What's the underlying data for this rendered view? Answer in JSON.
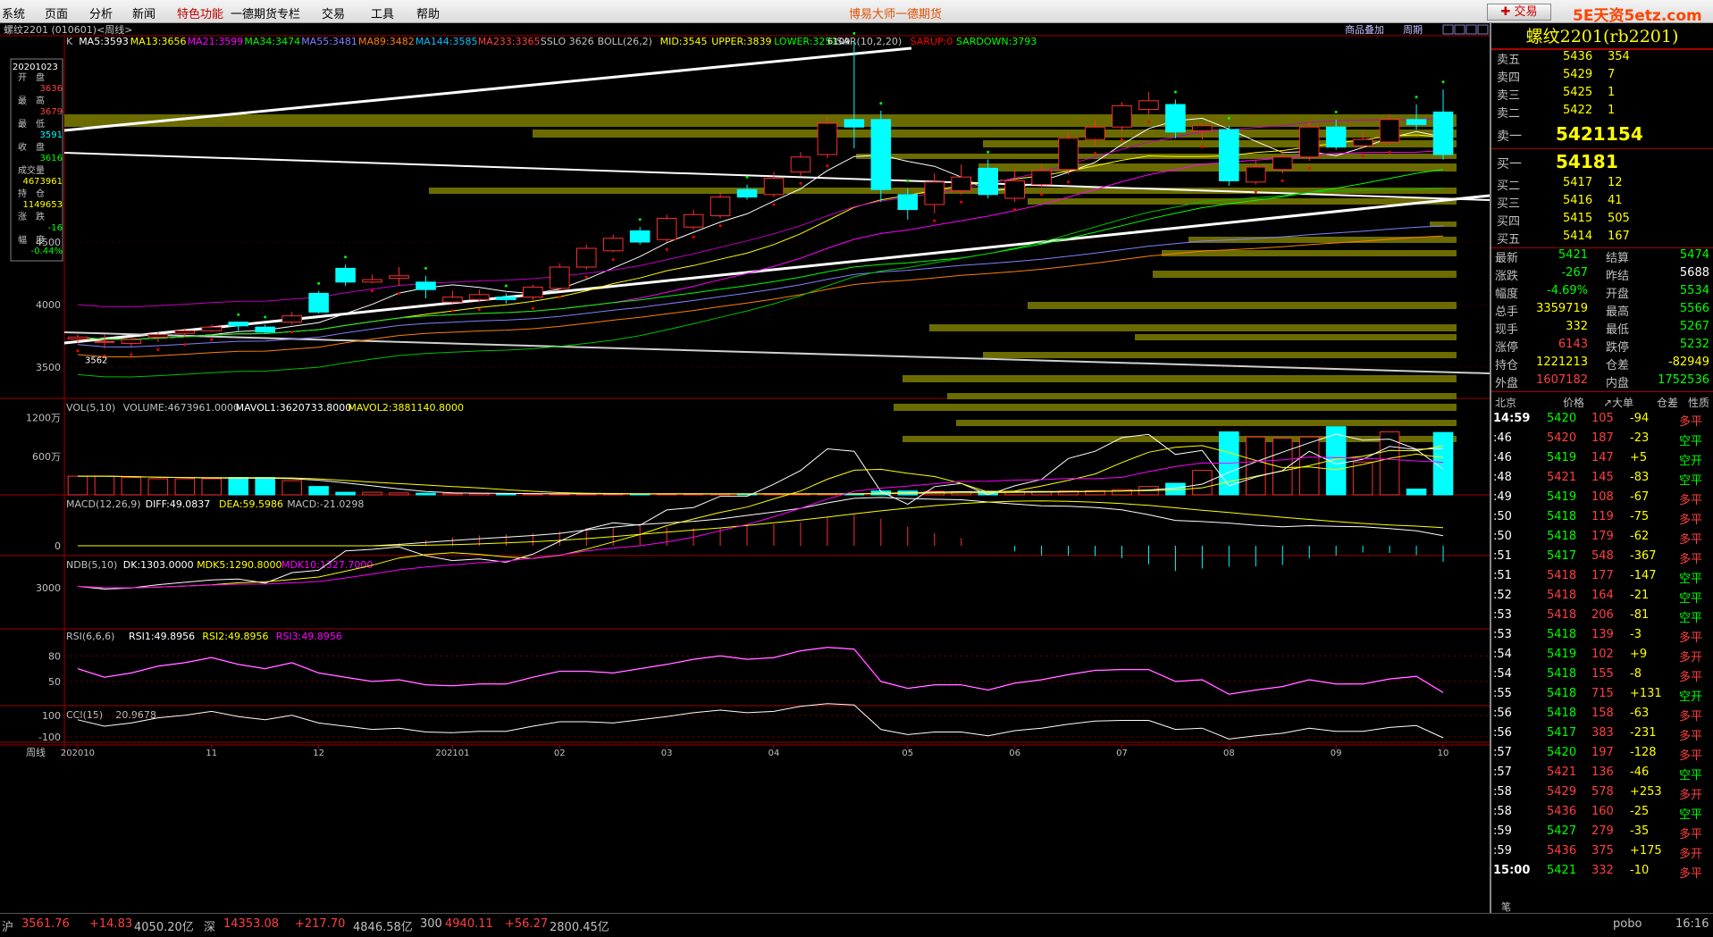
{
  "menu": [
    "系统",
    "页面",
    "分析",
    "新闻",
    "特色功能",
    "一德期货专栏",
    "交易",
    "工具",
    "帮助"
  ],
  "app_title": "博易大师一德期货",
  "trade_button": "交易",
  "watermark": "5E天资5etz.com",
  "chart_header": {
    "symbol": "螺纹2201 (010601)<周线>",
    "overlay_btn": "商品叠加",
    "period_btn": "周期"
  },
  "info_box": {
    "date": "20201023",
    "rows": [
      [
        "开　盘",
        "3636",
        "#ff4040"
      ],
      [
        "最　高",
        "3679",
        "#ff4040"
      ],
      [
        "最　低",
        "3591",
        "#00ffff"
      ],
      [
        "收　盘",
        "3616",
        "#00ff00"
      ],
      [
        "成交量",
        "4673961",
        "#ffff00"
      ],
      [
        "持　仓",
        "1149653",
        "#ffff00"
      ],
      [
        "涨　跌",
        "-16",
        "#00ff00"
      ],
      [
        "幅　度",
        "-0.44%",
        "#00ff00"
      ]
    ]
  },
  "indicators": {
    "ma_line": [
      [
        "K",
        "#c0c0c0"
      ],
      [
        "MA5:3593",
        "#ffffff"
      ],
      [
        "MA13:3656",
        "#ffff00"
      ],
      [
        "MA21:3599",
        "#ff00ff"
      ],
      [
        "MA34:3474",
        "#00ff00"
      ],
      [
        "MA55:3481",
        "#8080ff"
      ],
      [
        "MA89:3482",
        "#ff8000"
      ],
      [
        "MA144:3585",
        "#00c0ff"
      ],
      [
        "MA233:3365",
        "#ff4040"
      ],
      [
        "SSLO 3626",
        "#c0c0c0"
      ],
      [
        "BOLL(26,2)",
        "#c0c0c0"
      ],
      [
        "MID:3545",
        "#ffff00"
      ],
      [
        "UPPER:3839",
        "#ffff00"
      ],
      [
        "LOWER:3251",
        "#00ff00"
      ],
      [
        "SAR(10,2,20)",
        "#c0c0c0"
      ],
      [
        "SARUP:0",
        "#ff0000"
      ],
      [
        "SARDOWN:3793",
        "#00ff00"
      ]
    ],
    "vol": [
      [
        "VOL(5,10)",
        "#c0c0c0"
      ],
      [
        "VOLUME:4673961.0000",
        "#c0c0c0"
      ],
      [
        "MAVOL1:3620733.8000",
        "#ffffff"
      ],
      [
        "MAVOL2:3881140.8000",
        "#ffff00"
      ]
    ],
    "macd": [
      [
        "MACD(12,26,9)",
        "#c0c0c0"
      ],
      [
        "DIFF:49.0837",
        "#ffffff"
      ],
      [
        "DEA:59.5986",
        "#ffff00"
      ],
      [
        "MACD:-21.0298",
        "#c0c0c0"
      ]
    ],
    "ndb": [
      [
        "NDB(5,10)",
        "#c0c0c0"
      ],
      [
        "DK:1303.0000",
        "#ffffff"
      ],
      [
        "MDK5:1290.8000",
        "#ffff00"
      ],
      [
        "MDK10:1327.7000",
        "#ff00ff"
      ]
    ],
    "rsi": [
      [
        "RSI(6,6,6)",
        "#c0c0c0"
      ],
      [
        "RSI1:49.8956",
        "#ffffff"
      ],
      [
        "RSI2:49.8956",
        "#ffff00"
      ],
      [
        "RSI3:49.8956",
        "#ff00ff"
      ]
    ],
    "cci": [
      [
        "CCI(15)",
        "#c0c0c0"
      ],
      [
        "-20.9678",
        "#c0c0c0"
      ]
    ]
  },
  "price_axis": [
    "4500",
    "4000",
    "3500"
  ],
  "vol_axis": [
    "1200万",
    "600万"
  ],
  "macd_axis": [
    "0"
  ],
  "ndb_axis": [
    "3000"
  ],
  "rsi_axis": [
    "80",
    "50"
  ],
  "cci_axis": [
    "100",
    "-100"
  ],
  "annot_high": "6109",
  "annot_low": "3562",
  "xaxis": {
    "period_label": "周线",
    "labels": [
      "202010",
      "11",
      "12",
      "202101",
      "02",
      "03",
      "04",
      "05",
      "06",
      "07",
      "08",
      "09",
      "10"
    ]
  },
  "chart_data": {
    "type": "candlestick",
    "period": "weekly",
    "symbol": "螺纹2201",
    "ylim": [
      3250,
      6150
    ],
    "candles": [
      [
        3725,
        3740,
        3690,
        3760
      ],
      [
        3700,
        3705,
        3650,
        3760
      ],
      [
        3690,
        3720,
        3660,
        3740
      ],
      [
        3740,
        3760,
        3700,
        3780
      ],
      [
        3770,
        3790,
        3740,
        3810
      ],
      [
        3790,
        3820,
        3780,
        3840
      ],
      [
        3860,
        3830,
        3790,
        3860
      ],
      [
        3820,
        3780,
        3770,
        3840
      ],
      [
        3860,
        3910,
        3840,
        3940
      ],
      [
        4090,
        3940,
        3930,
        4110
      ],
      [
        4290,
        4180,
        4150,
        4320
      ],
      [
        4180,
        4200,
        4170,
        4240
      ],
      [
        4210,
        4230,
        4150,
        4300
      ],
      [
        4180,
        4120,
        4050,
        4230
      ],
      [
        4020,
        4060,
        4010,
        4110
      ],
      [
        4040,
        4080,
        4020,
        4120
      ],
      [
        4060,
        4040,
        4010,
        4090
      ],
      [
        4060,
        4140,
        4030,
        4160
      ],
      [
        4130,
        4300,
        4120,
        4330
      ],
      [
        4300,
        4450,
        4280,
        4480
      ],
      [
        4430,
        4530,
        4420,
        4560
      ],
      [
        4590,
        4500,
        4480,
        4620
      ],
      [
        4520,
        4690,
        4500,
        4720
      ],
      [
        4620,
        4720,
        4600,
        4760
      ],
      [
        4710,
        4860,
        4690,
        4900
      ],
      [
        4920,
        4860,
        4840,
        4960
      ],
      [
        4880,
        5010,
        4860,
        5060
      ],
      [
        5060,
        5180,
        5030,
        5220
      ],
      [
        5200,
        5450,
        5170,
        5500
      ],
      [
        5480,
        5420,
        5250,
        6109
      ],
      [
        5480,
        4920,
        4820,
        5550
      ],
      [
        4880,
        4760,
        4680,
        4930
      ],
      [
        4800,
        4980,
        4730,
        5050
      ],
      [
        4910,
        5020,
        4880,
        5120
      ],
      [
        5090,
        4880,
        4850,
        5160
      ],
      [
        4850,
        4990,
        4820,
        5080
      ],
      [
        4960,
        5070,
        4940,
        5120
      ],
      [
        5080,
        5330,
        5040,
        5380
      ],
      [
        5320,
        5420,
        5270,
        5480
      ],
      [
        5420,
        5590,
        5380,
        5620
      ],
      [
        5560,
        5630,
        5520,
        5700
      ],
      [
        5600,
        5380,
        5330,
        5640
      ],
      [
        5390,
        5430,
        5320,
        5450
      ],
      [
        5400,
        4990,
        4950,
        5430
      ],
      [
        4980,
        5100,
        4960,
        5150
      ],
      [
        5080,
        5180,
        5050,
        5230
      ],
      [
        5180,
        5420,
        5150,
        5460
      ],
      [
        5420,
        5260,
        5240,
        5480
      ],
      [
        5270,
        5320,
        5250,
        5380
      ],
      [
        5300,
        5480,
        5280,
        5520
      ],
      [
        5480,
        5440,
        5400,
        5600
      ],
      [
        5540,
        5200,
        5160,
        5720
      ]
    ],
    "volume": [
      2.9,
      2.9,
      2.7,
      2.5,
      2.5,
      2.5,
      2.7,
      2.7,
      2.2,
      1.3,
      0.4,
      0.4,
      0.3,
      0.25,
      0.2,
      0.2,
      0.15,
      0.15,
      0.15,
      0.15,
      0.15,
      0.15,
      0.15,
      0.15,
      0.15,
      0.15,
      0.15,
      0.15,
      0.15,
      0.15,
      0.6,
      0.6,
      0.55,
      0.5,
      0.5,
      0.5,
      0.5,
      0.6,
      0.65,
      0.8,
      1.3,
      1.8,
      3.8,
      9.8,
      9.0,
      8.8,
      9.0,
      10.6,
      5.1,
      9.8,
      0.9,
      9.7
    ],
    "rsi1": [
      65,
      55,
      60,
      68,
      72,
      78,
      70,
      65,
      72,
      60,
      55,
      50,
      52,
      46,
      45,
      47,
      47,
      55,
      62,
      62,
      60,
      65,
      70,
      76,
      80,
      76,
      78,
      86,
      90,
      88,
      50,
      42,
      46,
      46,
      40,
      48,
      52,
      58,
      63,
      64,
      64,
      50,
      52,
      35,
      40,
      44,
      52,
      47,
      47,
      53,
      56,
      37
    ]
  },
  "orderbook": {
    "title": "螺纹2201(rb2201)",
    "asks": [
      [
        "卖五",
        "5436",
        "354"
      ],
      [
        "卖四",
        "5429",
        "7"
      ],
      [
        "卖三",
        "5425",
        "1"
      ],
      [
        "卖二",
        "5422",
        "1"
      ]
    ],
    "ask1": [
      "卖一",
      "5421",
      "154"
    ],
    "bid1": [
      "买一",
      "5418",
      "1"
    ],
    "bids": [
      [
        "买二",
        "5417",
        "12"
      ],
      [
        "买三",
        "5416",
        "41"
      ],
      [
        "买四",
        "5415",
        "505"
      ],
      [
        "买五",
        "5414",
        "167"
      ]
    ]
  },
  "stats": [
    [
      [
        "最新",
        "5421",
        "#00ff00"
      ],
      [
        "结算",
        "5474",
        "#00ff00"
      ]
    ],
    [
      [
        "涨跌",
        "-267",
        "#00ff00"
      ],
      [
        "昨结",
        "5688",
        "#ffffff"
      ]
    ],
    [
      [
        "幅度",
        "-4.69%",
        "#00ff00"
      ],
      [
        "开盘",
        "5534",
        "#00ff00"
      ]
    ],
    [
      [
        "总手",
        "3359719",
        "#ffff00"
      ],
      [
        "最高",
        "5566",
        "#00ff00"
      ]
    ],
    [
      [
        "现手",
        "332",
        "#ffff00"
      ],
      [
        "最低",
        "5267",
        "#00ff00"
      ]
    ],
    [
      [
        "涨停",
        "6143",
        "#ff4040"
      ],
      [
        "跌停",
        "5232",
        "#00ff00"
      ]
    ],
    [
      [
        "持仓",
        "1221213",
        "#ffff00"
      ],
      [
        "仓差",
        "-82949",
        "#ffff00"
      ]
    ],
    [
      [
        "外盘",
        "1607182",
        "#ff4040"
      ],
      [
        "内盘",
        "1752536",
        "#00ff00"
      ]
    ]
  ],
  "ticks_header": [
    "北京",
    "价格",
    "↗大单",
    "仓差",
    "性质"
  ],
  "ticks": [
    [
      "14:59",
      "5420",
      "105",
      "-94",
      "多平"
    ],
    [
      ":46",
      "5420",
      "187",
      "-23",
      "空平"
    ],
    [
      ":46",
      "5419",
      "147",
      "+5",
      "空开"
    ],
    [
      ":48",
      "5421",
      "145",
      "-83",
      "空平"
    ],
    [
      ":49",
      "5419",
      "108",
      "-67",
      "多平"
    ],
    [
      ":50",
      "5418",
      "119",
      "-75",
      "多平"
    ],
    [
      ":50",
      "5418",
      "179",
      "-62",
      "多平"
    ],
    [
      ":51",
      "5417",
      "548",
      "-367",
      "多平"
    ],
    [
      ":51",
      "5418",
      "177",
      "-147",
      "空平"
    ],
    [
      ":52",
      "5418",
      "164",
      "-21",
      "空平"
    ],
    [
      ":53",
      "5418",
      "206",
      "-81",
      "空平"
    ],
    [
      ":53",
      "5418",
      "139",
      "-3",
      "多平"
    ],
    [
      ":54",
      "5419",
      "102",
      "+9",
      "多开"
    ],
    [
      ":54",
      "5418",
      "155",
      "-8",
      "多平"
    ],
    [
      ":55",
      "5418",
      "715",
      "+131",
      "空开"
    ],
    [
      ":56",
      "5418",
      "158",
      "-63",
      "多平"
    ],
    [
      ":56",
      "5417",
      "383",
      "-231",
      "多平"
    ],
    [
      ":57",
      "5420",
      "197",
      "-128",
      "多平"
    ],
    [
      ":57",
      "5421",
      "136",
      "-46",
      "空平"
    ],
    [
      ":58",
      "5429",
      "578",
      "+253",
      "多开"
    ],
    [
      ":58",
      "5436",
      "160",
      "-25",
      "空平"
    ],
    [
      ":59",
      "5427",
      "279",
      "-35",
      "多平"
    ],
    [
      ":59",
      "5436",
      "375",
      "+175",
      "多开"
    ],
    [
      "15:00",
      "5421",
      "332",
      "-10",
      "多平"
    ]
  ],
  "tick_colors": [
    "#00ff00",
    "#ff4040",
    "#00ff00",
    "#ff4040",
    "#00ff00",
    "#00ff00",
    "#00ff00",
    "#00ff00",
    "#ff4040",
    "#ff4040",
    "#ff4040",
    "#00ff00",
    "#00ff00",
    "#00ff00",
    "#00ff00",
    "#00ff00",
    "#00ff00",
    "#00ff00",
    "#ff4040",
    "#ff4040",
    "#ff4040",
    "#00ff00",
    "#ff4040",
    "#00ff00"
  ],
  "status": [
    [
      "沪",
      "#c0c0c0"
    ],
    [
      "3561.76",
      "#ff4040"
    ],
    [
      "+14.83",
      "#ff4040"
    ],
    [
      "4050.20亿",
      "#c0c0c0"
    ],
    [
      "深",
      "#c0c0c0"
    ],
    [
      "14353.08",
      "#ff4040"
    ],
    [
      "+217.70",
      "#ff4040"
    ],
    [
      "4846.58亿",
      "#c0c0c0"
    ],
    [
      "300",
      "#c0c0c0"
    ],
    [
      "4940.11",
      "#ff4040"
    ],
    [
      "+56.27",
      "#ff4040"
    ],
    [
      "2800.45亿",
      "#c0c0c0"
    ]
  ],
  "status_right": {
    "brand": "pobo",
    "time": "16:16"
  },
  "footer_tab": "笔"
}
